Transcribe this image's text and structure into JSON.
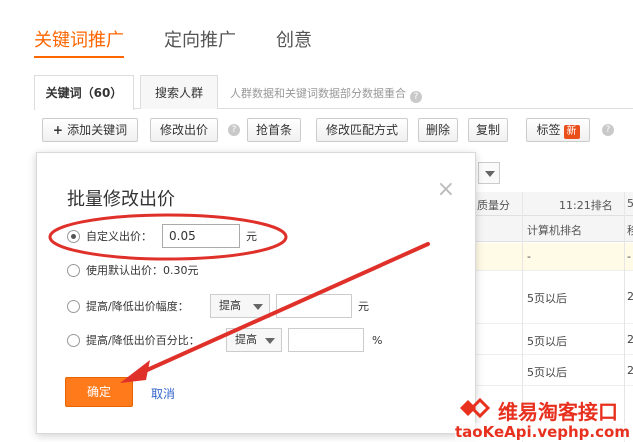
{
  "topnav": {
    "items": [
      "关键词推广",
      "定向推广",
      "创意"
    ]
  },
  "subtabs": {
    "active": "关键词（60）",
    "second": "搜索人群",
    "note": "人群数据和关键词数据部分数据重合"
  },
  "toolbar": {
    "add": "添加关键词",
    "edit_bid": "修改出价",
    "grab": "抢首条",
    "match": "修改匹配方式",
    "delete": "删除",
    "copy": "复制",
    "tag": "标签",
    "tag_badge": "新"
  },
  "table_bg": {
    "col1_head": "质量分",
    "col2_head": "11:21排名",
    "col3_head": "5",
    "sub_head": "计算机排名",
    "sub_head2": "移",
    "rows": [
      {
        "a": "-",
        "b": "-"
      },
      {
        "a": "5页以后",
        "b": "2"
      },
      {
        "a": "5页以后",
        "b": "2"
      },
      {
        "a": "5页以后",
        "b": "2"
      }
    ]
  },
  "modal": {
    "title": "批量修改出价",
    "close": "×",
    "custom_label": "自定义出价：",
    "custom_value": "0.05",
    "unit_yuan": "元",
    "default_label": "使用默认出价：0.30元",
    "range_label": "提高/降低出价幅度：",
    "range_option": "提高",
    "range_unit": "元",
    "pct_label": "提高/降低出价百分比：",
    "pct_option": "提高",
    "pct_unit": "%",
    "ok": "确定",
    "cancel": "取消"
  },
  "watermark": {
    "text": "维易淘客接口",
    "url": "taoKeApi.vephp.com"
  },
  "colors": {
    "accent": "#ff6600",
    "annotation": "#e0302a",
    "link": "#3366cc"
  }
}
